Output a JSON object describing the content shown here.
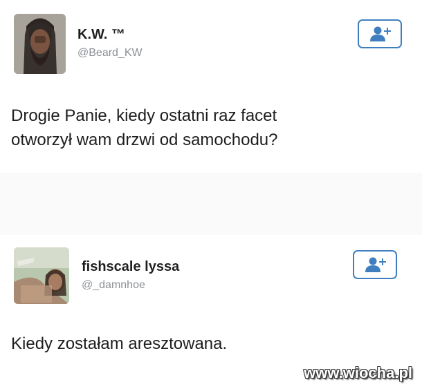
{
  "tweets": [
    {
      "display_name": "K.W. ™",
      "handle": "@Beard_KW",
      "text_lines": [
        "Drogie Panie, kiedy ostatni raz facet",
        "otworzył wam drzwi od samochodu?"
      ],
      "follow_icon": "add-user-icon"
    },
    {
      "display_name": "fishscale lyssa",
      "handle": "@_damnhoe",
      "text_lines": [
        "Kiedy zostałam aresztowana."
      ],
      "follow_icon": "add-user-icon"
    }
  ],
  "watermark": "www.wiocha.pl",
  "colors": {
    "accent": "#3f7fbf",
    "handle": "#8a8f94"
  }
}
